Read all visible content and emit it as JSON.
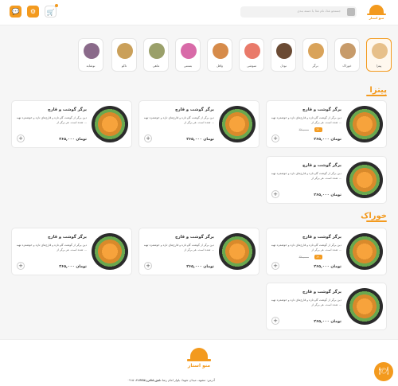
{
  "header": {
    "logo_text": "منو استار",
    "search_placeholder": "جستجو غذا، نام غذا یا دسته بندی",
    "icons": [
      "search-icon",
      "cart-icon",
      "settings-icon",
      "chat-icon"
    ]
  },
  "categories": [
    {
      "label": "پیتزا",
      "color": "#e7c08a",
      "active": true
    },
    {
      "label": "خوراک",
      "color": "#c79b6a",
      "active": false
    },
    {
      "label": "برگر",
      "color": "#d9a35a",
      "active": false
    },
    {
      "label": "نودل",
      "color": "#6b4b34",
      "active": false
    },
    {
      "label": "سوشی",
      "color": "#e97a6a",
      "active": false
    },
    {
      "label": "وافل",
      "color": "#d68b4a",
      "active": false
    },
    {
      "label": "بستنی",
      "color": "#d86aa8",
      "active": false
    },
    {
      "label": "ماهی",
      "color": "#9aa06a",
      "active": false
    },
    {
      "label": "تاکو",
      "color": "#caa05a",
      "active": false
    },
    {
      "label": "نوشابه",
      "color": "#8a6a8a",
      "active": false
    }
  ],
  "sections": [
    {
      "title": "پیتزا"
    },
    {
      "title": "خوراک"
    }
  ],
  "product": {
    "name": "برگر گوشت و قارچ",
    "desc": "دین برگر از گوشت گاو تازه و قارچ‌های تازه و خوشمزه تهیه شده است. هر برگر از ...",
    "price": "۲۶۵,۰۰۰ تومان",
    "badge": "٪۲۰",
    "old_price": "۳۲۰,۰۰۰"
  },
  "footer": {
    "logo_text": "منو استار",
    "address": "آدرس: مشهد، میدان شهدا، بلوار امام رضا، نبش امام رضا ۲",
    "phone": "تلفن تماس: ۰۹۱۵۰۸۷۸۷۸۳"
  }
}
